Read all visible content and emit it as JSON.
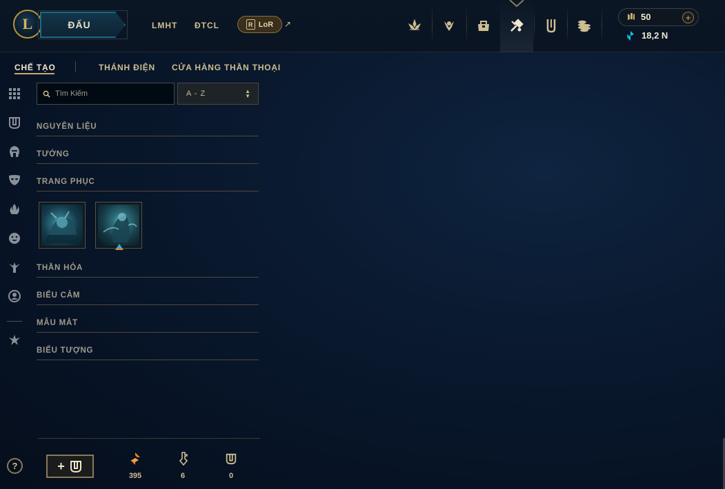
{
  "topbar": {
    "logo": "L",
    "play_label": "ĐẤU",
    "links": [
      "LMHT",
      "ĐTCL"
    ],
    "lor_label": "LoR",
    "lor_badge": "R",
    "ext_arrow": "↗",
    "nav_icons": [
      "home-icon",
      "profile-icon",
      "collection-icon",
      "loot-icon",
      "clash-icon",
      "store-icon"
    ],
    "active_nav": "loot-icon",
    "rp": "50",
    "be": "18,2 N",
    "plus": "+"
  },
  "subtabs": {
    "crafting": "CHẾ TẠO",
    "sanctum": "THÁNH ĐIỆN",
    "mythic_shop": "CỬA HÀNG THẦN THOẠI"
  },
  "search": {
    "placeholder": "Tìm Kiếm"
  },
  "sort": {
    "value": "A - Z"
  },
  "categories": [
    "NGUYÊN LIỆU",
    "TƯỚNG",
    "TRANG PHỤC",
    "THẦN HỎA",
    "BIỂU CẢM",
    "MẪU MẮT",
    "BIỂU TƯỢNG"
  ],
  "footer": {
    "craft_plus": "+",
    "resources": [
      {
        "icon": "orange-essence-icon",
        "value": "395"
      },
      {
        "icon": "key-fragment-icon",
        "value": "6"
      },
      {
        "icon": "chest-icon",
        "value": "0"
      }
    ]
  },
  "help": "?",
  "colors": {
    "gold": "#cdbe91",
    "gold_border": "#8a7a58",
    "teal": "#1a6b80",
    "background": "#0a1a30"
  }
}
